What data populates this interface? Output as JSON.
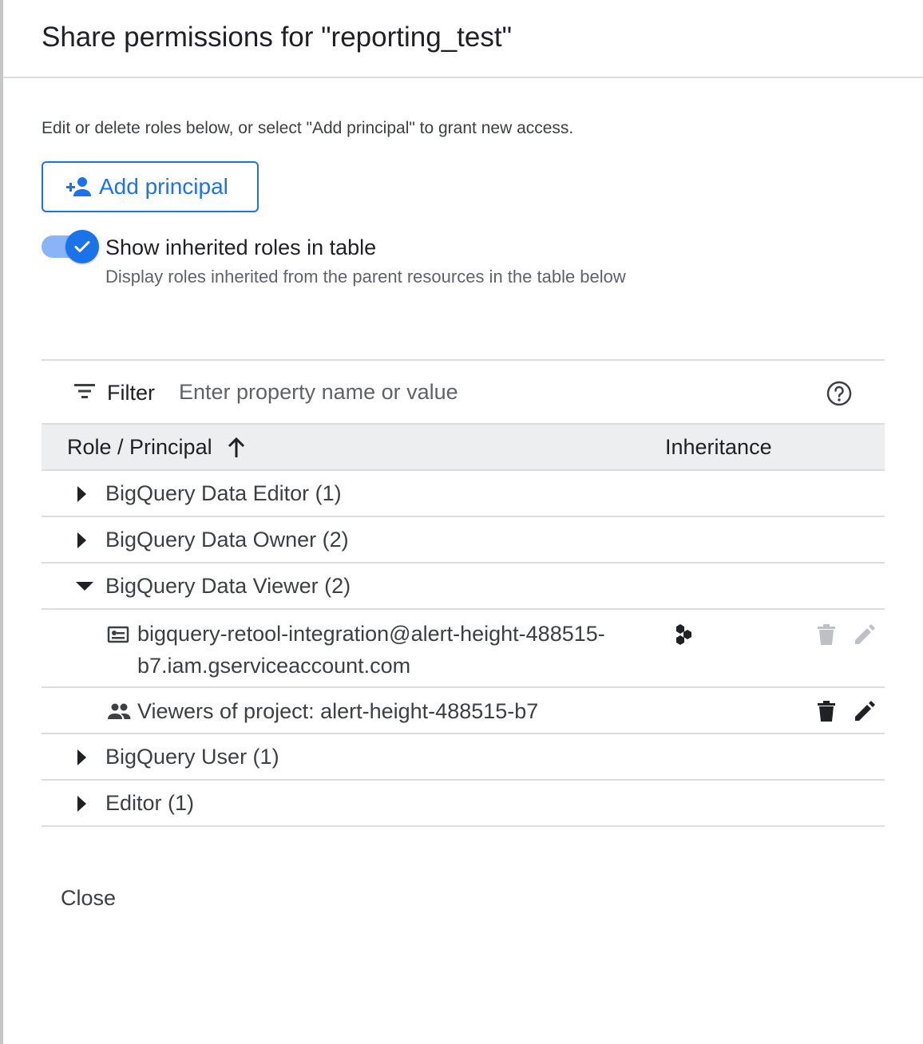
{
  "dialog": {
    "title": "Share permissions for \"reporting_test\"",
    "description": "Edit or delete roles below, or select \"Add principal\" to grant new access.",
    "add_principal_label": "Add principal",
    "toggle": {
      "label": "Show inherited roles in table",
      "sublabel": "Display roles inherited from the parent resources in the table below",
      "on": true
    },
    "close_label": "Close"
  },
  "filter": {
    "label": "Filter",
    "placeholder": "Enter property name or value"
  },
  "table": {
    "col_role": "Role / Principal",
    "col_inheritance": "Inheritance",
    "roles": [
      {
        "label": "BigQuery Data Editor (1)",
        "expanded": false
      },
      {
        "label": "BigQuery Data Owner (2)",
        "expanded": false
      },
      {
        "label": "BigQuery Data Viewer (2)",
        "expanded": true
      },
      {
        "label": "BigQuery User (1)",
        "expanded": false
      },
      {
        "label": "Editor (1)",
        "expanded": false
      }
    ],
    "principals": [
      {
        "line1": "bigquery-retool-integration@alert-height-488515-",
        "line2": "b7.iam.gserviceaccount.com",
        "type_icon": "service-account-icon",
        "inheritance_icon": "project-hierarchy-icon",
        "actions_enabled": false
      },
      {
        "line1": "Viewers of project: alert-height-488515-b7",
        "type_icon": "group-icon",
        "actions_enabled": true
      }
    ]
  },
  "colors": {
    "accent": "#1a73e8",
    "toggle_track": "#8ab4f8",
    "header_bg": "#eceef0",
    "divider": "#dadce0",
    "disabled_icon": "#bdc1c6"
  }
}
